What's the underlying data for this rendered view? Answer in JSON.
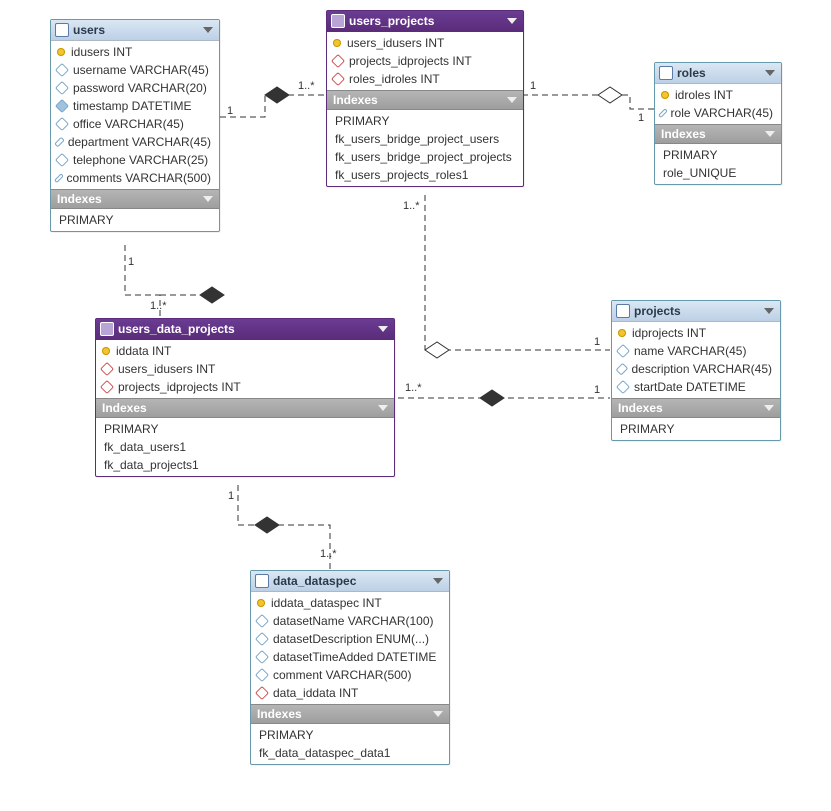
{
  "section_labels": {
    "indexes": "Indexes"
  },
  "tables": {
    "users": {
      "title": "users",
      "columns": [
        {
          "kind": "pk",
          "text": "idusers INT"
        },
        {
          "kind": "attr",
          "text": "username VARCHAR(45)"
        },
        {
          "kind": "attr",
          "text": "password VARCHAR(20)"
        },
        {
          "kind": "attrf",
          "text": "timestamp DATETIME"
        },
        {
          "kind": "attr",
          "text": "office VARCHAR(45)"
        },
        {
          "kind": "attr",
          "text": "department VARCHAR(45)"
        },
        {
          "kind": "attr",
          "text": "telephone VARCHAR(25)"
        },
        {
          "kind": "attr",
          "text": "comments VARCHAR(500)"
        }
      ],
      "indexes": [
        "PRIMARY"
      ]
    },
    "users_projects": {
      "title": "users_projects",
      "columns": [
        {
          "kind": "pk",
          "text": "users_idusers INT"
        },
        {
          "kind": "fk",
          "text": "projects_idprojects INT"
        },
        {
          "kind": "fk",
          "text": "roles_idroles INT"
        }
      ],
      "indexes": [
        "PRIMARY",
        "fk_users_bridge_project_users",
        "fk_users_bridge_project_projects",
        "fk_users_projects_roles1"
      ]
    },
    "roles": {
      "title": "roles",
      "columns": [
        {
          "kind": "pk",
          "text": "idroles INT"
        },
        {
          "kind": "attr",
          "text": "role VARCHAR(45)"
        }
      ],
      "indexes": [
        "PRIMARY",
        "role_UNIQUE"
      ]
    },
    "users_data_projects": {
      "title": "users_data_projects",
      "columns": [
        {
          "kind": "pk",
          "text": "iddata INT"
        },
        {
          "kind": "fk",
          "text": "users_idusers INT"
        },
        {
          "kind": "fk",
          "text": "projects_idprojects INT"
        }
      ],
      "indexes": [
        "PRIMARY",
        "fk_data_users1",
        "fk_data_projects1"
      ]
    },
    "projects": {
      "title": "projects",
      "columns": [
        {
          "kind": "pk",
          "text": "idprojects INT"
        },
        {
          "kind": "attr",
          "text": "name VARCHAR(45)"
        },
        {
          "kind": "attr",
          "text": "description VARCHAR(45)"
        },
        {
          "kind": "attr",
          "text": "startDate DATETIME"
        }
      ],
      "indexes": [
        "PRIMARY"
      ]
    },
    "data_dataspec": {
      "title": "data_dataspec",
      "columns": [
        {
          "kind": "pk",
          "text": "iddata_dataspec INT"
        },
        {
          "kind": "attr",
          "text": "datasetName VARCHAR(100)"
        },
        {
          "kind": "attr",
          "text": "datasetDescription ENUM(...)"
        },
        {
          "kind": "attr",
          "text": "datasetTimeAdded DATETIME"
        },
        {
          "kind": "attr",
          "text": "comment VARCHAR(500)"
        },
        {
          "kind": "fk",
          "text": "data_iddata INT"
        }
      ],
      "indexes": [
        "PRIMARY",
        "fk_data_dataspec_data1"
      ]
    }
  },
  "cardinalities": {
    "users_to_up_1": "1",
    "users_to_up_many": "1..*",
    "up_to_roles_1": "1",
    "roles_side_1": "1",
    "up_down": "1..*",
    "users_to_udp_1": "1",
    "users_to_udp_many": "1..*",
    "udp_right_many": "1..*",
    "projects_upper_1": "1",
    "projects_lower_1": "1",
    "udp_to_ds_1": "1",
    "udp_to_ds_many": "1..*"
  }
}
